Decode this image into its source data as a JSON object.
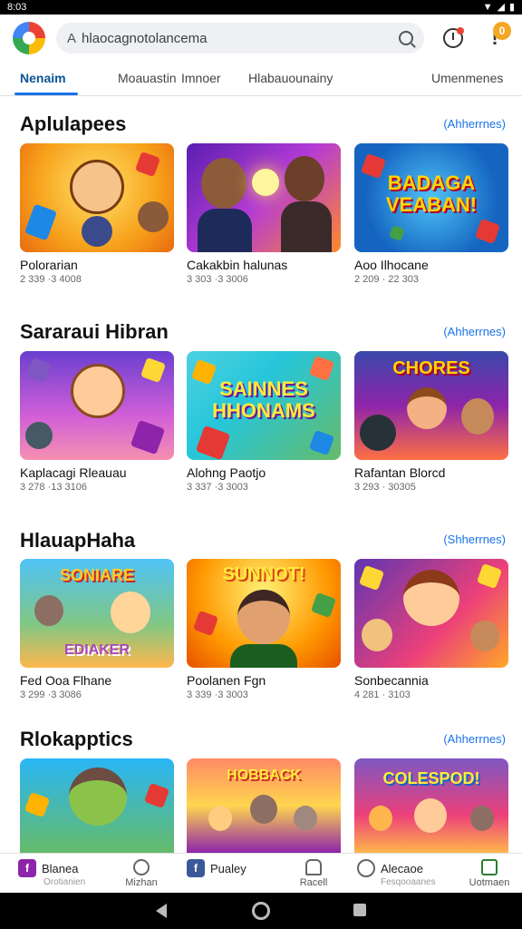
{
  "status": {
    "time": "8:03"
  },
  "search": {
    "query": "hlaocagnotolancema"
  },
  "header": {
    "alert_badge": "0"
  },
  "tabs": [
    {
      "label": "Nenaim"
    },
    {
      "label": "Moauastin"
    },
    {
      "label": "Imnoer"
    },
    {
      "label": "Hlabauounainy"
    },
    {
      "label": "Umenmenes"
    }
  ],
  "sections": [
    {
      "title": "Aplulapees",
      "more": "Ahherrnes",
      "items": [
        {
          "title": "Polorarian",
          "meta": "2 339 ·3 4008"
        },
        {
          "title": "Cakakbin halunas",
          "meta": "3 303 ·3 3006"
        },
        {
          "title": "Aoo Ilhocane",
          "meta": "2 209 · 22 303"
        }
      ]
    },
    {
      "title": "Sararaui Hibran",
      "more": "Ahherrnes",
      "items": [
        {
          "title": "Kaplacagi Rleauau",
          "meta": "3 278 ·13 3106"
        },
        {
          "title": "Alohng Paotjo",
          "meta": "3 337 ·3 3003"
        },
        {
          "title": "Rafantan Blorcd",
          "meta": "3 293 · 30305"
        }
      ]
    },
    {
      "title": "HlauapHaha",
      "more": "Shherrnes",
      "items": [
        {
          "title": "Fed Ooa Flhane",
          "meta": "3 299 ·3 3086"
        },
        {
          "title": "Poolanen Fgn",
          "meta": "3 339 ·3 3003"
        },
        {
          "title": "Sonbecannia",
          "meta": "4 281 · 3103"
        }
      ]
    },
    {
      "title": "Rlokapptics",
      "more": "Ahherrnes",
      "items": [
        {},
        {},
        {}
      ]
    }
  ],
  "bottom_nav": [
    {
      "label": "Blanea",
      "sub": "Orotianien"
    },
    {
      "label": "Mizhan"
    },
    {
      "label": "Pualey"
    },
    {
      "label": "Racell"
    },
    {
      "label": "Alecaoe",
      "sub": "Fesqooaanes"
    },
    {
      "label": "Uotmaen"
    }
  ],
  "thumb_texts": {
    "s1_c3": "BADAGA\nVEABAN!",
    "s2_c2": "SAINNES\nHHONAMS",
    "s2_c3": "CHORES",
    "s3_c1": "SONIARE",
    "s3_c1b": "EDIAKER",
    "s3_c2": "SUNNOT!",
    "s4_c2": "HOBBACK",
    "s4_c3": "COLESPOD!"
  },
  "colors": {
    "accent": "#1a73e8",
    "badge": "#f5a623"
  }
}
